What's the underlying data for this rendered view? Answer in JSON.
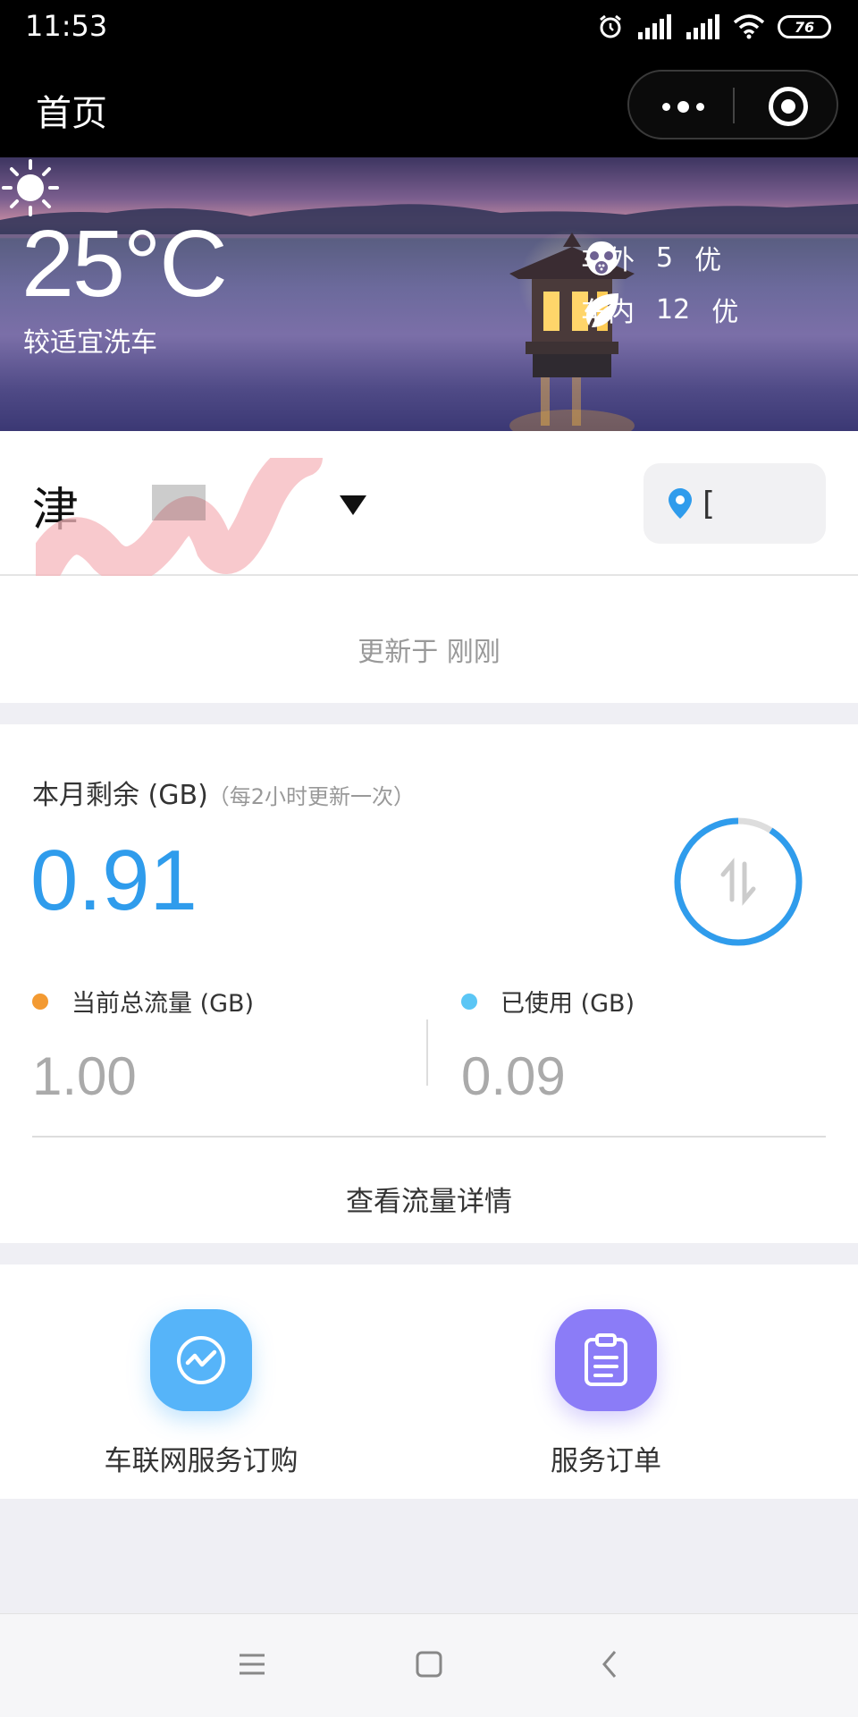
{
  "status_bar": {
    "time": "11:53",
    "battery": "76"
  },
  "nav": {
    "title": "首页"
  },
  "weather": {
    "temperature": "25°C",
    "wash_index": "较适宜洗车",
    "outside": {
      "label": "车外",
      "value": "5",
      "level": "优"
    },
    "inside": {
      "label": "车内",
      "value": "12",
      "level": "优"
    }
  },
  "vehicle": {
    "plate": "津",
    "location": "["
  },
  "updated": "更新于 刚刚",
  "data_usage": {
    "remaining_label": "本月剩余 (GB)",
    "remaining_note": "（每2小时更新一次）",
    "remaining_value": "0.91",
    "remaining_fraction": 0.91,
    "total_label": "当前总流量 (GB)",
    "total_value": "1.00",
    "used_label": "已使用 (GB)",
    "used_value": "0.09",
    "details_link": "查看流量详情",
    "colors": {
      "accent": "#2f9cec",
      "total_dot": "#f39a32",
      "used_dot": "#5bc6f5",
      "ring_track": "#dddddd"
    }
  },
  "services": [
    {
      "label": "车联网服务订购",
      "icon": "trend-chart-icon",
      "color": "#56b4f9"
    },
    {
      "label": "服务订单",
      "icon": "clipboard-icon",
      "color": "#8b7cf7"
    }
  ]
}
